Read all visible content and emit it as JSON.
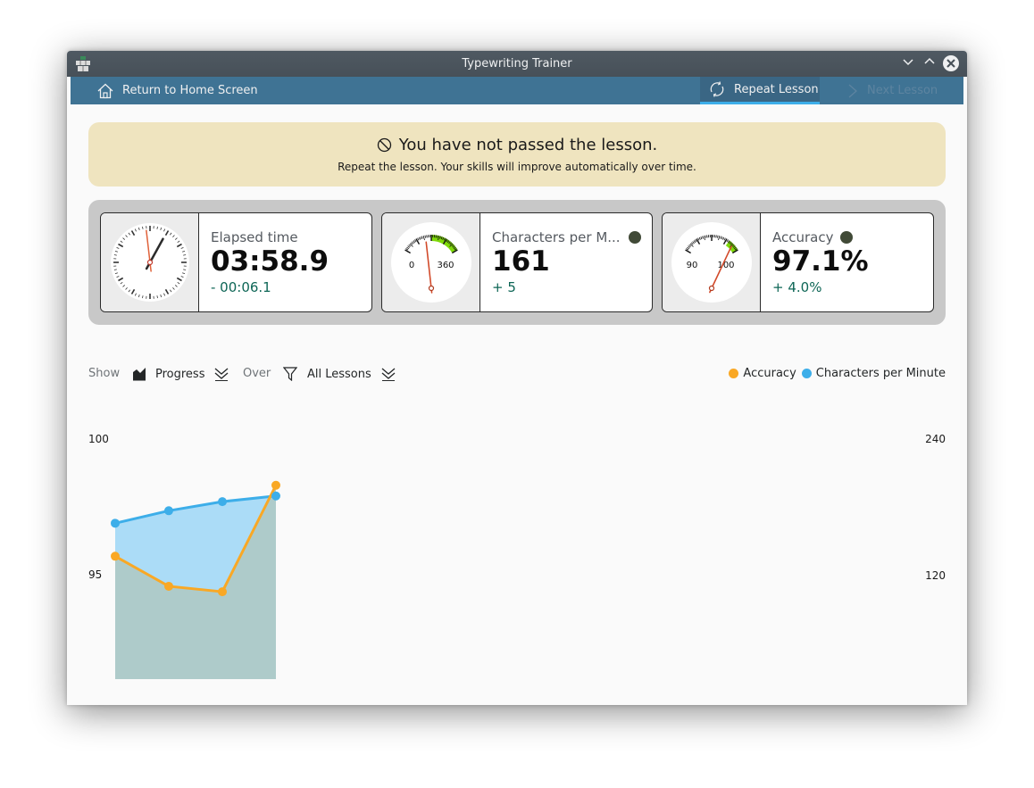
{
  "window": {
    "title": "Typewriting Trainer",
    "app_icon": "keyboard-icon",
    "controls": {
      "minimize": "chevron-down-icon",
      "maximize": "chevron-up-icon",
      "close": "close-icon"
    }
  },
  "toolbar": {
    "home_label": "Return to Home Screen",
    "repeat_label": "Repeat Lesson",
    "next_label": "Next Lesson",
    "next_enabled": false,
    "active_color": "#3daee9"
  },
  "banner": {
    "icon": "forbidden-icon",
    "title": "You have not passed the lesson.",
    "subtitle": "Repeat the lesson. Your skills will improve automatically over time.",
    "background": "#efe4bf"
  },
  "stats": {
    "elapsed": {
      "label": "Elapsed time",
      "value": "03:58.9",
      "diff": "- 00:06.1"
    },
    "cpm": {
      "label": "Characters per M...",
      "value": "161",
      "diff": "+ 5",
      "gauge_min_label": "0",
      "gauge_max_label": "360",
      "gauge_value": 161,
      "status_color": "#414a37"
    },
    "accuracy": {
      "label": "Accuracy",
      "value": "97.1%",
      "diff": "+ 4.0%",
      "gauge_min_label": "90",
      "gauge_max_label": "100",
      "gauge_value": 97.1,
      "status_color": "#414a37"
    }
  },
  "controls": {
    "show_label": "Show",
    "show_value": "Progress",
    "over_label": "Over",
    "over_value": "All Lessons"
  },
  "legend": {
    "accuracy": "Accuracy",
    "cpm": "Characters per Minute"
  },
  "chart_data": {
    "type": "line",
    "title": "",
    "x": [
      1,
      2,
      3,
      4
    ],
    "series": [
      {
        "name": "Accuracy",
        "axis": "left",
        "color": "#f9a825",
        "values": [
          94.5,
          93.4,
          93.2,
          97.1
        ]
      },
      {
        "name": "Characters per Minute",
        "axis": "right",
        "color": "#3daee9",
        "values": [
          137,
          148,
          156,
          161
        ]
      }
    ],
    "left_axis": {
      "range": [
        90,
        100
      ],
      "ticks": [
        "100",
        "95"
      ]
    },
    "right_axis": {
      "range": [
        0,
        240
      ],
      "ticks": [
        "240",
        "120"
      ]
    },
    "grid": true,
    "legend_position": "top-right"
  }
}
